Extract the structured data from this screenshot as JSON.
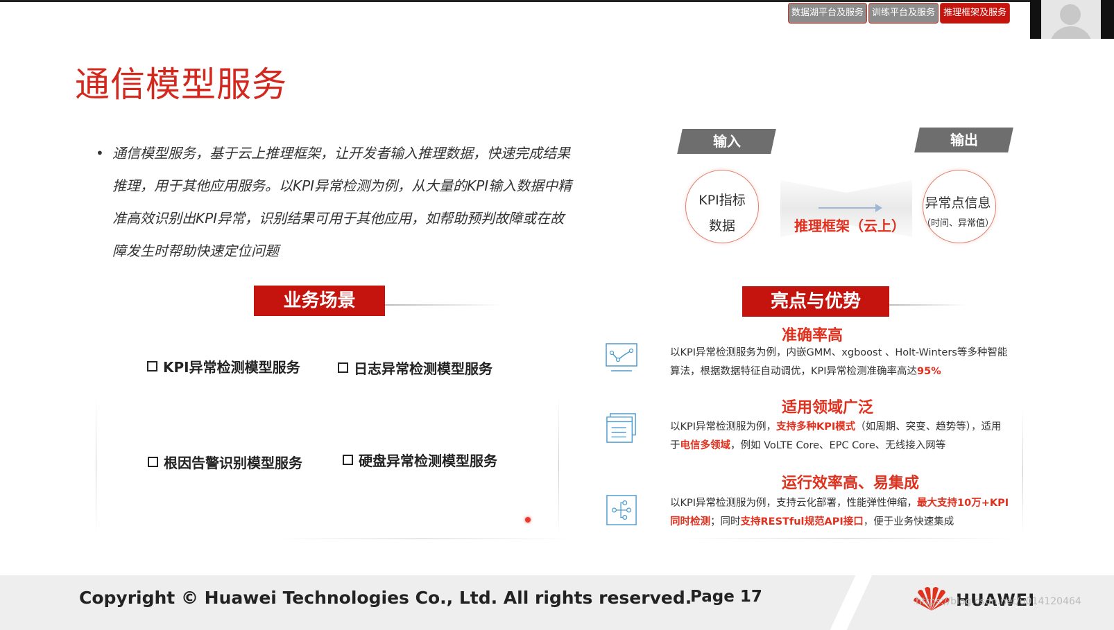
{
  "nav": {
    "tabs": [
      {
        "label": "数据湖平台及服务",
        "active": false
      },
      {
        "label": "训练平台及服务",
        "active": false
      },
      {
        "label": "推理框架及服务",
        "active": true
      }
    ]
  },
  "slide": {
    "title": "通信模型服务",
    "bullet": {
      "lines": [
        "通信模型服务，基于云上推理框架，让开发者输入推理数据，快速完成结果",
        "推理，用于其他应用服务。以KPI异常检测为例，从大量的KPI输入数据中精",
        "准高效识别出KPI异常，识别结果可用于其他应用，如帮助预判故障或在故",
        "障发生时帮助快速定位问题"
      ]
    },
    "scenarios": {
      "heading": "业务场景",
      "items": [
        "KPI异常检测模型服务",
        "日志异常检测模型服务",
        "根因告警识别模型服务",
        "硬盘异常检测模型服务"
      ]
    },
    "flow": {
      "input_label": "输入",
      "output_label": "输出",
      "input_circle": {
        "line1": "KPI指标",
        "line2": "数据"
      },
      "output_circle": {
        "line1": "异常点信息",
        "line2": "（时间、异常值）"
      },
      "framework": "推理框架（云上）"
    },
    "advantages": {
      "heading": "亮点与优势",
      "items": [
        {
          "title": "准确率高",
          "icon": "chart-line-icon",
          "p1": "以KPI异常检测服务为例，内嵌GMM、xgboost 、Holt-Winters等多种智能算法，根据数据特征自动调优，KPI异常检测准确率高达",
          "h1": "95%"
        },
        {
          "title": "适用领域广泛",
          "icon": "document-window-icon",
          "p1": "以KPI异常检测服为例，",
          "h1": "支持多种KPI模式",
          "p2": "（如周期、突变、趋势等），适用于",
          "h2": "电信多领域",
          "p3": "，例如 VoLTE Core、EPC Core、无线接入网等"
        },
        {
          "title": "运行效率高、易集成",
          "icon": "branch-network-icon",
          "p1": "以KPI异常检测服为例，支持云化部署，性能弹性伸缩，",
          "h1": "最大支持10万+KPI同时检测",
          "p2": "；同时",
          "h2": "支持RESTful规范API接口",
          "p3": "，便于业务快速集成"
        }
      ]
    }
  },
  "footer": {
    "copyright": "Copyright © Huawei Technologies Co., Ltd. All rights reserved.",
    "page": "Page 17",
    "brand": "HUAWEI",
    "watermark": "https://blog.csdn.net/u014120464"
  },
  "colors": {
    "accent": "#c4140d",
    "highlight": "#e0301e",
    "badge": "#6e6e6e"
  }
}
